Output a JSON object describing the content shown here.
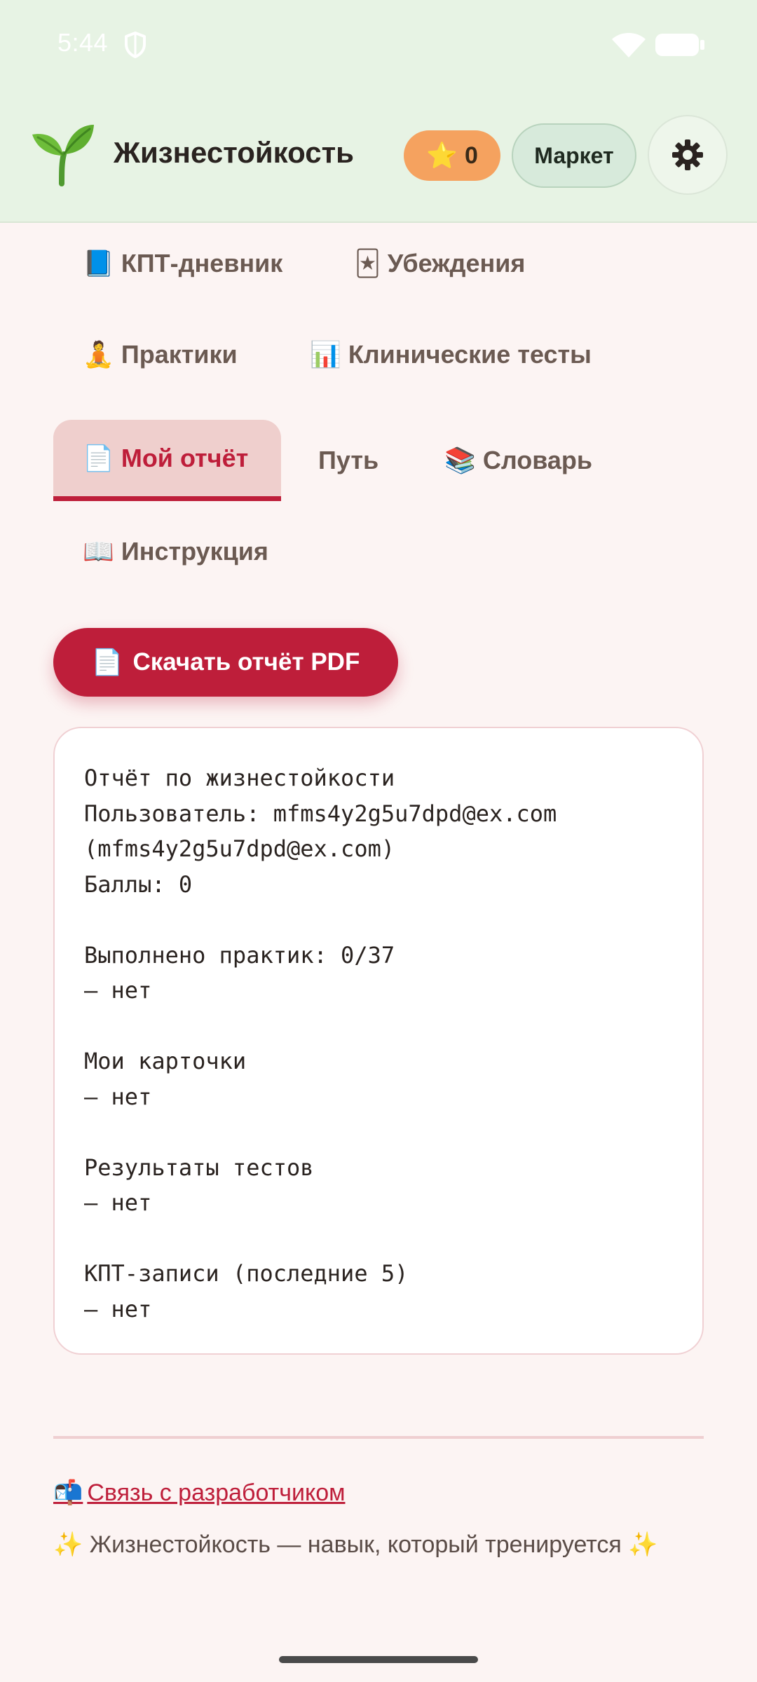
{
  "status_bar": {
    "time": "5:44",
    "icons": [
      "shield-icon",
      "wifi-icon",
      "battery-icon"
    ]
  },
  "header": {
    "logo_icon": "🌱",
    "title": "Жизнестойкость",
    "score": {
      "icon": "⭐",
      "value": "0"
    },
    "market_label": "Маркет",
    "settings_icon": "gear-icon"
  },
  "tabs": [
    {
      "icon": "📘",
      "label": "КПТ-дневник",
      "active": false
    },
    {
      "icon": "🃏",
      "label": "Убеждения",
      "active": false
    },
    {
      "icon": "🧘",
      "label": "Практики",
      "active": false
    },
    {
      "icon": "📊",
      "label": "Клинические тесты",
      "active": false
    },
    {
      "icon": "📄",
      "label": "Мой отчёт",
      "active": true
    },
    {
      "icon": "",
      "label": "Путь",
      "active": false
    },
    {
      "icon": "📚",
      "label": "Словарь",
      "active": false
    },
    {
      "icon": "📖",
      "label": "Инструкция",
      "active": false
    }
  ],
  "download": {
    "icon": "📄",
    "label": "Скачать отчёт PDF"
  },
  "report": {
    "text": "Отчёт по жизнестойкости\nПользователь: mfms4y2g5u7dpd@ex.com\n(mfms4y2g5u7dpd@ex.com)\nБаллы: 0\n\nВыполнено практик: 0/37\n— нет\n\nМои карточки\n— нет\n\nРезультаты тестов\n— нет\n\nКПТ-записи (последние 5)\n— нет"
  },
  "footer": {
    "contact_icon": "📬",
    "contact_label": "Связь с разработчиком",
    "tagline": "✨ Жизнестойкость — навык, который тренируется ✨"
  },
  "colors": {
    "accent": "#be1e3a",
    "header_bg": "#e7f3e4",
    "page_bg": "#fcf4f3",
    "score_badge": "#f5a25f",
    "active_tab_bg": "#efcfcd"
  }
}
